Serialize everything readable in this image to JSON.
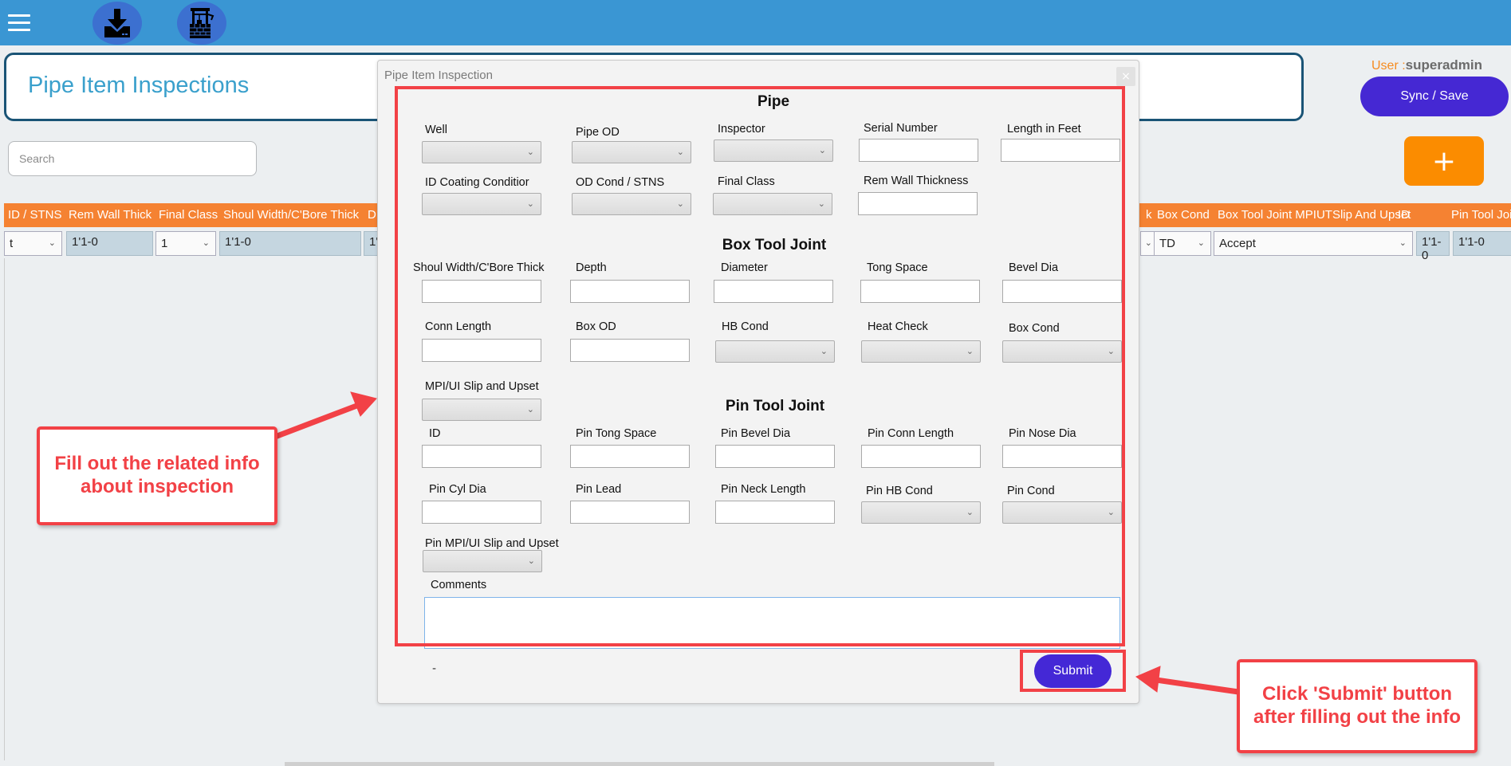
{
  "topbar": {
    "menu_icon": "hamburger-icon",
    "buttons": [
      {
        "icon": "download-icon",
        "label": "Download"
      },
      {
        "icon": "well-icon",
        "label": "Well"
      }
    ]
  },
  "header": {
    "title": "Pipe Item Inspections",
    "user_prefix": "User :",
    "user_name": "superadmin",
    "sync_label": "Sync / Save",
    "add_label": "+"
  },
  "search": {
    "placeholder": "Search",
    "value": ""
  },
  "table": {
    "header_color": "#f58232",
    "columns_left": [
      "ID / STNS",
      "Rem Wall Thick",
      "Final Class",
      "Shoul Width/C'Bore Thick",
      "D"
    ],
    "columns_right": [
      "k",
      "Box Cond",
      "Box Tool Joint MPIUTSlip And Upset",
      "ID",
      "Pin Tool Joi"
    ],
    "row": {
      "id_stns": "t",
      "rem_wall_thick": "1'1-0",
      "final_class": "1",
      "shoul_width": "1'1-0",
      "depth_partial": "1'",
      "box_cond": "TD",
      "box_mpi": "Accept",
      "id": "1'1-0",
      "pin_tool_joint": "1'1-0"
    }
  },
  "dialog": {
    "title": "Pipe Item Inspection",
    "close_label": "×",
    "sections": {
      "pipe": {
        "heading": "Pipe",
        "fields": [
          {
            "label": "Well",
            "type": "select",
            "value": ""
          },
          {
            "label": "Pipe OD",
            "type": "select",
            "value": ""
          },
          {
            "label": "Inspector",
            "type": "select",
            "value": ""
          },
          {
            "label": "Serial Number",
            "type": "text",
            "value": ""
          },
          {
            "label": "Length in Feet",
            "type": "text",
            "value": ""
          },
          {
            "label": "ID Coating Conditior",
            "type": "select",
            "value": ""
          },
          {
            "label": "OD Cond / STNS",
            "type": "select",
            "value": ""
          },
          {
            "label": "Final Class",
            "type": "select",
            "value": ""
          },
          {
            "label": "Rem Wall Thickness",
            "type": "text",
            "value": ""
          }
        ]
      },
      "box": {
        "heading": "Box Tool Joint",
        "fields": [
          {
            "label": "Shoul Width/C'Bore Thick",
            "type": "text",
            "value": ""
          },
          {
            "label": "Depth",
            "type": "text",
            "value": ""
          },
          {
            "label": "Diameter",
            "type": "text",
            "value": ""
          },
          {
            "label": "Tong Space",
            "type": "text",
            "value": ""
          },
          {
            "label": "Bevel Dia",
            "type": "text",
            "value": ""
          },
          {
            "label": "Conn Length",
            "type": "text",
            "value": ""
          },
          {
            "label": "Box OD",
            "type": "text",
            "value": ""
          },
          {
            "label": "HB Cond",
            "type": "select",
            "value": ""
          },
          {
            "label": "Heat Check",
            "type": "select",
            "value": ""
          },
          {
            "label": "Box Cond",
            "type": "select",
            "value": ""
          },
          {
            "label": "MPI/UI Slip and Upset",
            "type": "select",
            "value": ""
          }
        ]
      },
      "pin": {
        "heading": "Pin Tool Joint",
        "fields": [
          {
            "label": "ID",
            "type": "text",
            "value": ""
          },
          {
            "label": "Pin Tong Space",
            "type": "text",
            "value": ""
          },
          {
            "label": "Pin Bevel Dia",
            "type": "text",
            "value": ""
          },
          {
            "label": "Pin Conn Length",
            "type": "text",
            "value": ""
          },
          {
            "label": "Pin Nose Dia",
            "type": "text",
            "value": ""
          },
          {
            "label": "Pin Cyl Dia",
            "type": "text",
            "value": ""
          },
          {
            "label": "Pin Lead",
            "type": "text",
            "value": ""
          },
          {
            "label": "Pin Neck Length",
            "type": "text",
            "value": ""
          },
          {
            "label": "Pin HB Cond",
            "type": "select",
            "value": ""
          },
          {
            "label": "Pin Cond",
            "type": "select",
            "value": ""
          },
          {
            "label": "Pin MPI/UI Slip and Upset",
            "type": "select",
            "value": ""
          }
        ]
      }
    },
    "comments_label": "Comments",
    "comments_value": "",
    "status_text": "-",
    "submit_label": "Submit"
  },
  "annotations": {
    "color": "#f24146",
    "callout_fill": "Fill out the related info about inspection",
    "callout_submit": "Click 'Submit' button after filling out the info"
  }
}
